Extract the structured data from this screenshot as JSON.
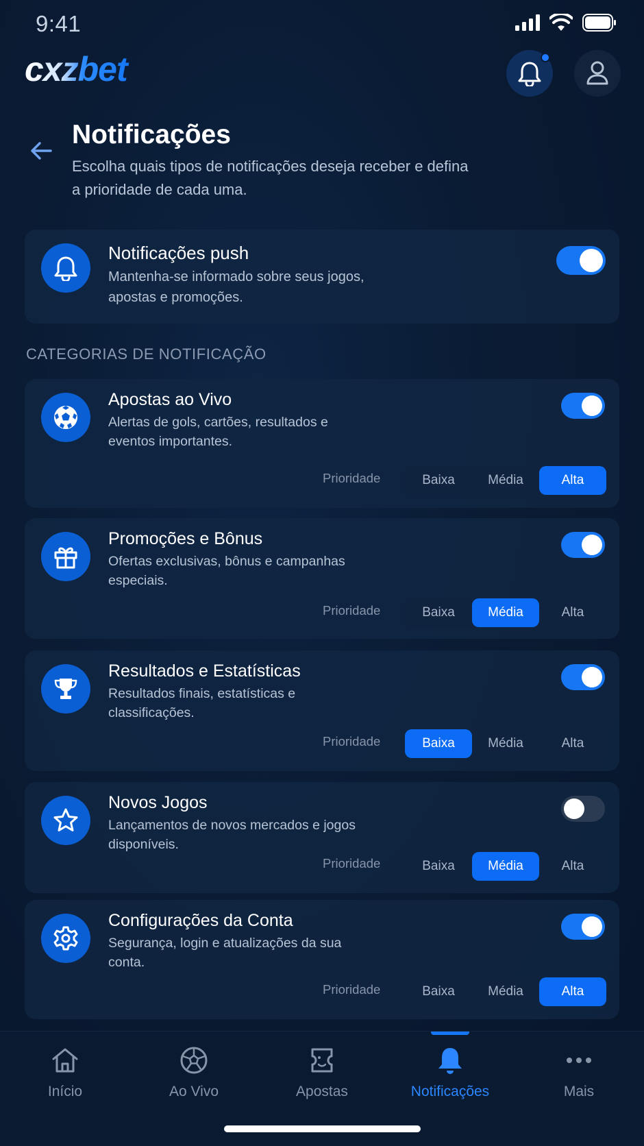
{
  "status_bar": {
    "time": "9:41"
  },
  "header": {
    "logo_text": "cxzbet"
  },
  "page": {
    "title": "Notificações",
    "subtitle": "Escolha quais tipos de notificações deseja receber e defina a prioridade de cada uma."
  },
  "push": {
    "title": "Notificações push",
    "description": "Mantenha-se informado sobre seus jogos, apostas e promoções.",
    "enabled": true
  },
  "section_title": "CATEGORIAS DE NOTIFICAÇÃO",
  "priority_label": "Prioridade",
  "priority_options": [
    "Baixa",
    "Média",
    "Alta"
  ],
  "categories": [
    {
      "icon": "soccer-ball-icon",
      "title": "Apostas ao Vivo",
      "description": "Alertas de gols, cartões, resultados e eventos importantes.",
      "enabled": true,
      "priority": "Alta"
    },
    {
      "icon": "gift-icon",
      "title": "Promoções e Bônus",
      "description": "Ofertas exclusivas, bônus e campanhas especiais.",
      "enabled": true,
      "priority": "Média"
    },
    {
      "icon": "trophy-icon",
      "title": "Resultados e Estatísticas",
      "description": "Resultados finais, estatísticas e classificações.",
      "enabled": true,
      "priority": "Baixa"
    },
    {
      "icon": "star-icon",
      "title": "Novos Jogos",
      "description": "Lançamentos de novos mercados e jogos disponíveis.",
      "enabled": false,
      "priority": "Média"
    },
    {
      "icon": "gear-icon",
      "title": "Configurações da Conta",
      "description": "Segurança, login e atualizações da sua conta.",
      "enabled": true,
      "priority": "Alta"
    }
  ],
  "bottom_nav": {
    "items": [
      {
        "label": "Início",
        "icon": "home-icon",
        "active": false
      },
      {
        "label": "Ao Vivo",
        "icon": "soccer-ball-icon",
        "active": false
      },
      {
        "label": "Apostas",
        "icon": "ticket-icon",
        "active": false
      },
      {
        "label": "Notificações",
        "icon": "bell-icon",
        "active": true
      },
      {
        "label": "Mais",
        "icon": "more-dots-icon",
        "active": false
      }
    ]
  },
  "colors": {
    "accent": "#1676f3",
    "background": "#0a1b33",
    "card": "#112642",
    "text_secondary": "#b7c4d6"
  }
}
